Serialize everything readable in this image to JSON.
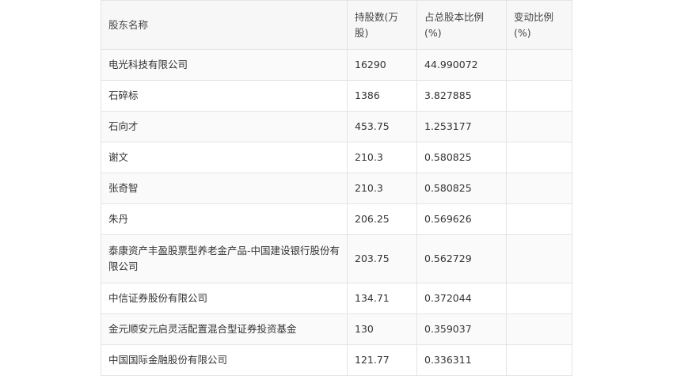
{
  "table": {
    "headers": [
      "股东名称",
      "持股数(万股)",
      "占总股本比例(%)",
      "变动比例(%)"
    ],
    "rows": [
      {
        "name": "电光科技有限公司",
        "shares": "16290",
        "ratio": "44.990072",
        "change": ""
      },
      {
        "name": "石碎标",
        "shares": "1386",
        "ratio": "3.827885",
        "change": ""
      },
      {
        "name": "石向才",
        "shares": "453.75",
        "ratio": "1.253177",
        "change": ""
      },
      {
        "name": "谢文",
        "shares": "210.3",
        "ratio": "0.580825",
        "change": ""
      },
      {
        "name": "张奇智",
        "shares": "210.3",
        "ratio": "0.580825",
        "change": ""
      },
      {
        "name": "朱丹",
        "shares": "206.25",
        "ratio": "0.569626",
        "change": ""
      },
      {
        "name": "泰康资产丰盈股票型养老金产品-中国建设银行股份有限公司",
        "shares": "203.75",
        "ratio": "0.562729",
        "change": ""
      },
      {
        "name": "中信证券股份有限公司",
        "shares": "134.71",
        "ratio": "0.372044",
        "change": ""
      },
      {
        "name": "金元顺安元启灵活配置混合型证券投资基金",
        "shares": "130",
        "ratio": "0.359037",
        "change": ""
      },
      {
        "name": "中国国际金融股份有限公司",
        "shares": "121.77",
        "ratio": "0.336311",
        "change": ""
      }
    ]
  }
}
